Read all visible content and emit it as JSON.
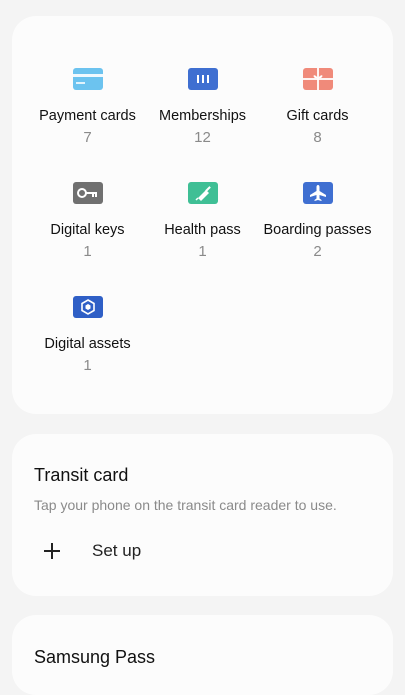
{
  "categories": [
    {
      "label": "Payment cards",
      "count": "7",
      "icon": "credit-card-icon",
      "color": "#6cc3ef"
    },
    {
      "label": "Memberships",
      "count": "12",
      "icon": "membership-card-icon",
      "color": "#3f6fd1"
    },
    {
      "label": "Gift cards",
      "count": "8",
      "icon": "gift-icon",
      "color": "#f08a7a"
    },
    {
      "label": "Digital keys",
      "count": "1",
      "icon": "key-icon",
      "color": "#707070"
    },
    {
      "label": "Health pass",
      "count": "1",
      "icon": "syringe-icon",
      "color": "#3fbf95"
    },
    {
      "label": "Boarding passes",
      "count": "2",
      "icon": "airplane-icon",
      "color": "#3f6fd1"
    },
    {
      "label": "Digital assets",
      "count": "1",
      "icon": "hexagon-token-icon",
      "color": "#2f5fc6"
    }
  ],
  "transit": {
    "title": "Transit card",
    "description": "Tap your phone on the transit card reader to use.",
    "setup_label": "Set up"
  },
  "samsung_pass": {
    "title": "Samsung Pass"
  }
}
